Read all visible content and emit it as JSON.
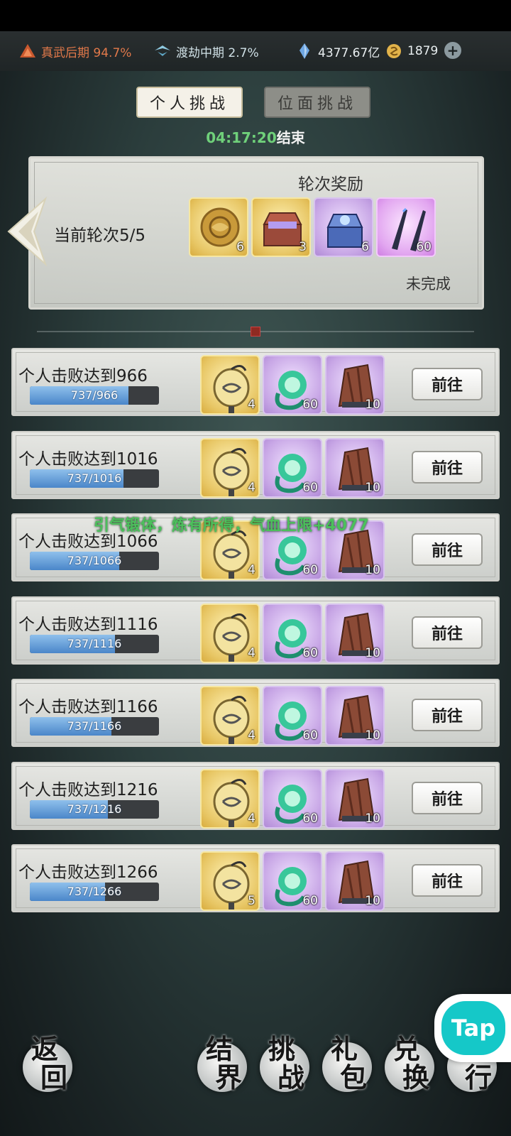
{
  "topbar": {
    "resources": [
      {
        "icon": "mountain-icon",
        "text": "真武后期 94.7%"
      },
      {
        "icon": "tribulation-icon",
        "text": "渡劫中期 2.7%"
      },
      {
        "icon": "crystal-icon",
        "text": "4377.67亿"
      },
      {
        "icon": "coin-icon",
        "text": "1879"
      }
    ],
    "plus": "+"
  },
  "tabs": {
    "personal": "个人挑战",
    "plane": "位面挑战"
  },
  "countdown": {
    "time": "04:17:20",
    "suffix": "结束"
  },
  "round_panel": {
    "round_label": "当前轮次5/5",
    "reward_title": "轮次奖励",
    "status": "未完成",
    "rewards": [
      {
        "icon": "gold-plate-icon",
        "qty": "6",
        "rarity": "gold"
      },
      {
        "icon": "treasure-chest-icon",
        "qty": "3",
        "rarity": "gold"
      },
      {
        "icon": "blue-chest-icon",
        "qty": "6",
        "rarity": "purple"
      },
      {
        "icon": "twin-blades-icon",
        "qty": "60",
        "rarity": "pink"
      }
    ]
  },
  "task_button_label": "前往",
  "tasks": [
    {
      "title": "个人击败达到966",
      "progress_text": "737/966",
      "progress": 0.763,
      "rewards": [
        "4",
        "60",
        "10"
      ]
    },
    {
      "title": "个人击败达到1016",
      "progress_text": "737/1016",
      "progress": 0.725,
      "rewards": [
        "4",
        "60",
        "10"
      ]
    },
    {
      "title": "个人击败达到1066",
      "progress_text": "737/1066",
      "progress": 0.691,
      "rewards": [
        "4",
        "60",
        "10"
      ]
    },
    {
      "title": "个人击败达到1116",
      "progress_text": "737/1116",
      "progress": 0.66,
      "rewards": [
        "4",
        "60",
        "10"
      ]
    },
    {
      "title": "个人击败达到1166",
      "progress_text": "737/1166",
      "progress": 0.632,
      "rewards": [
        "4",
        "60",
        "10"
      ]
    },
    {
      "title": "个人击败达到1216",
      "progress_text": "737/1216",
      "progress": 0.606,
      "rewards": [
        "4",
        "60",
        "10"
      ]
    },
    {
      "title": "个人击败达到1266",
      "progress_text": "737/1266",
      "progress": 0.582,
      "rewards": [
        "5",
        "60",
        "10"
      ]
    }
  ],
  "float_message": "引气锻体，炼有所得，气血上限+4077",
  "bottom_nav": [
    {
      "label1": "返",
      "label2": "回"
    },
    {
      "label1": "结",
      "label2": "界"
    },
    {
      "label1": "挑",
      "label2": "战"
    },
    {
      "label1": "礼",
      "label2": "包"
    },
    {
      "label1": "兑",
      "label2": "换"
    },
    {
      "label1": "排",
      "label2": "行"
    }
  ],
  "tap_badge": "Tap",
  "colors": {
    "countdown": "#6fd07a",
    "float_message": "#4cc05c",
    "progress_fill": "#4a86c9"
  }
}
